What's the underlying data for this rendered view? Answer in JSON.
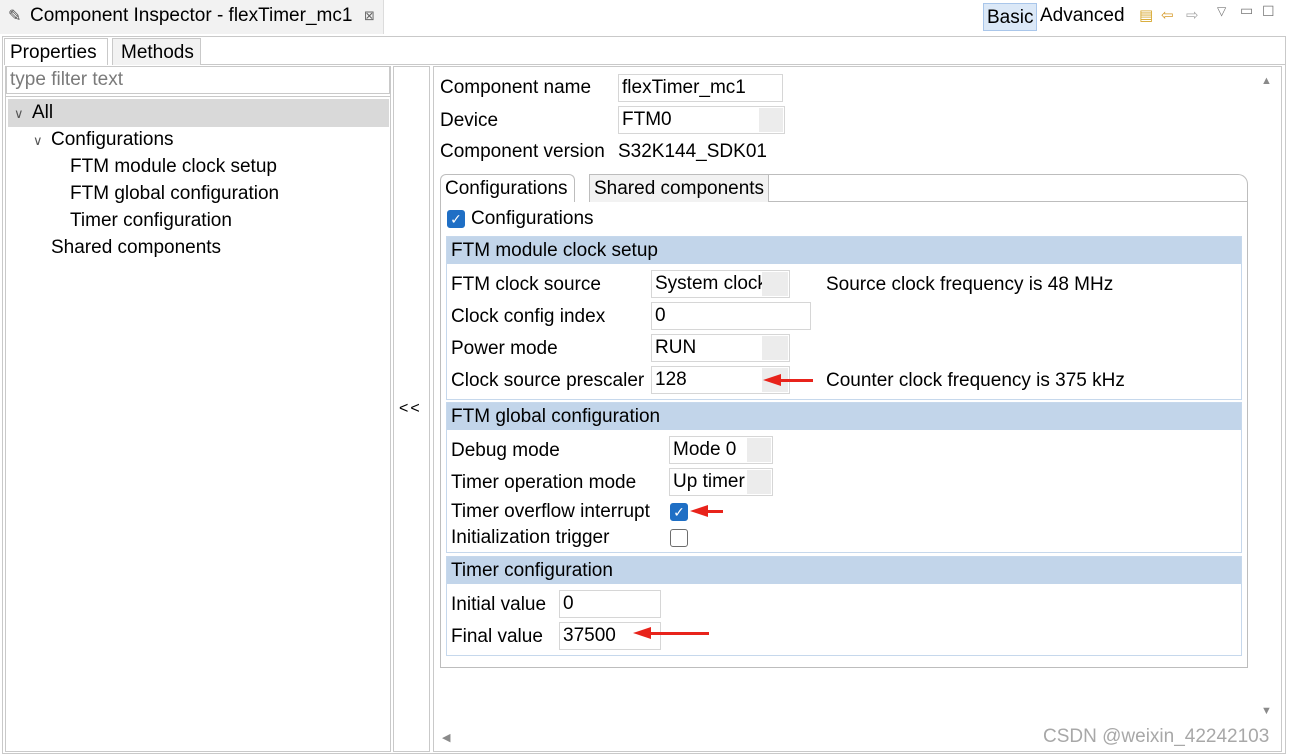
{
  "window": {
    "title": "Component Inspector - flexTimer_mc1",
    "close_glyph": "⊠",
    "mode_basic": "Basic",
    "mode_advanced": "Advanced",
    "icons": [
      "pencil-icon",
      "note-icon",
      "back-arrow-icon",
      "forward-arrow-icon",
      "view-menu-icon",
      "minimize-icon",
      "maximize-icon"
    ]
  },
  "left_tabs": [
    "Properties",
    "Methods"
  ],
  "filter": {
    "placeholder": "type filter text",
    "value": ""
  },
  "tree": {
    "all": "All",
    "configurations": "Configurations",
    "children": [
      "FTM module clock setup",
      "FTM global configuration",
      "Timer configuration"
    ],
    "shared": "Shared components"
  },
  "collapse_label": "<<",
  "component": {
    "name_label": "Component name",
    "name_value": "flexTimer_mc1",
    "device_label": "Device",
    "device_value": "FTM0",
    "version_label": "Component version",
    "version_value": "S32K144_SDK01"
  },
  "inner_tabs": [
    "Configurations",
    "Shared components"
  ],
  "configurations_checkbox": {
    "label": "Configurations",
    "checked": true
  },
  "sections": {
    "clock": {
      "title": "FTM module clock setup",
      "clock_source_label": "FTM clock source",
      "clock_source_value": "System clock",
      "clock_source_hint": "Source clock frequency is 48 MHz",
      "config_index_label": "Clock config index",
      "config_index_value": "0",
      "power_mode_label": "Power mode",
      "power_mode_value": "RUN",
      "prescaler_label": "Clock source prescaler",
      "prescaler_value": "128",
      "prescaler_hint": "Counter clock frequency is 375 kHz"
    },
    "global": {
      "title": "FTM global configuration",
      "debug_mode_label": "Debug mode",
      "debug_mode_value": "Mode 0",
      "op_mode_label": "Timer operation mode",
      "op_mode_value": "Up timer",
      "overflow_label": "Timer overflow interrupt",
      "overflow_checked": true,
      "init_trigger_label": "Initialization trigger",
      "init_trigger_checked": false
    },
    "timer": {
      "title": "Timer configuration",
      "initial_label": "Initial value",
      "initial_value": "0",
      "final_label": "Final value",
      "final_value": "37500"
    }
  },
  "annotation_color": "#e8231b",
  "accent_color": "#1f6fc5",
  "watermark": "CSDN @weixin_42242103"
}
